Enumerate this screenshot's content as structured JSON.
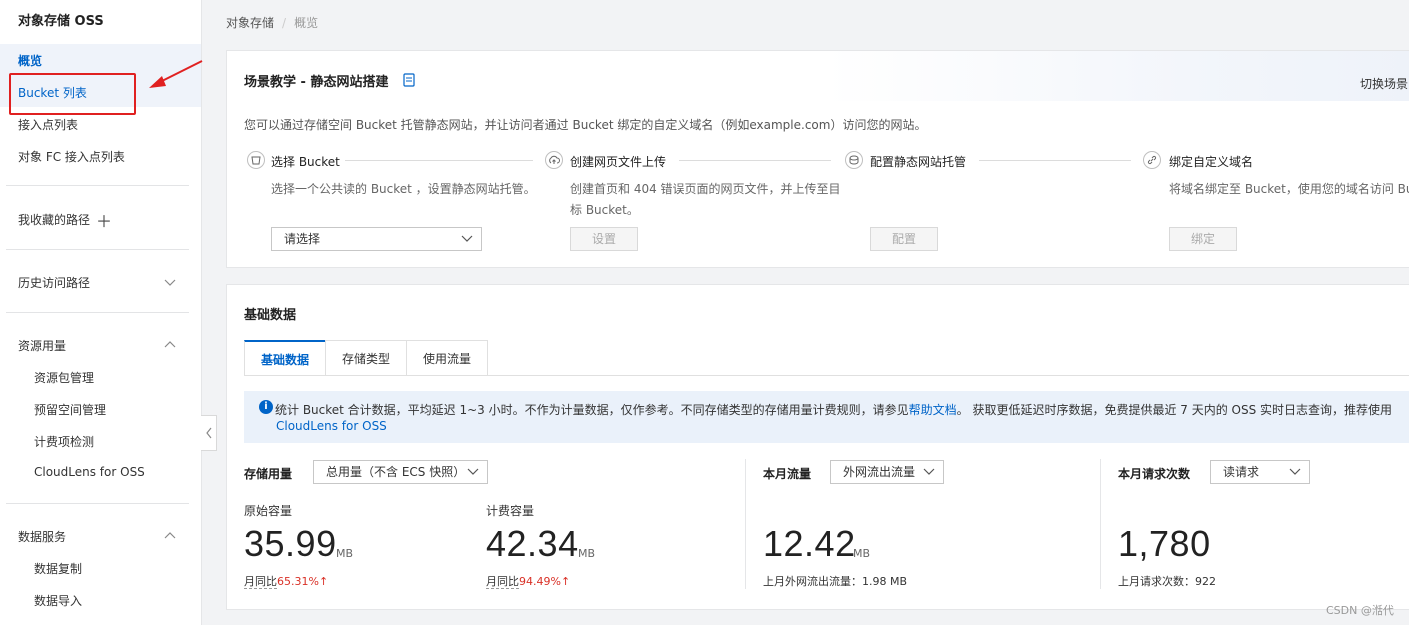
{
  "sidebar": {
    "title": "对象存储 OSS",
    "overview": "概览",
    "bucket_list": "Bucket 列表",
    "access_points": "接入点列表",
    "fc_access_points": "对象 FC 接入点列表",
    "favorites": "我收藏的路径",
    "history": "历史访问路径",
    "resource_usage": "资源用量",
    "resource_items": [
      "资源包管理",
      "预留空间管理",
      "计费项检测",
      "CloudLens for OSS"
    ],
    "data_services": "数据服务",
    "data_items": [
      "数据复制",
      "数据导入"
    ]
  },
  "breadcrumb": {
    "root": "对象存储",
    "current": "概览"
  },
  "scene": {
    "title": "场景教学 - 静态网站搭建",
    "switch": "切换场景",
    "description": "您可以通过存储空间 Bucket 托管静态网站，并让访问者通过 Bucket 绑定的自定义域名（例如example.com）访问您的网站。",
    "steps": [
      {
        "title": "选择 Bucket",
        "desc1": "选择一个公共读的 Bucket ，设置静态网站托管。",
        "desc2": "",
        "icon": "bucket-icon"
      },
      {
        "title": "创建网页文件上传",
        "desc1": "创建首页和 404 错误页面的网页文件，并上传至目",
        "desc2": "标 Bucket。",
        "icon": "cloud-upload-icon"
      },
      {
        "title": "配置静态网站托管",
        "desc1": "",
        "desc2": "",
        "icon": "config-icon"
      },
      {
        "title": "绑定自定义域名",
        "desc1": "将域名绑定至 Bucket，使用您的域名访问 Bu",
        "desc2": "",
        "icon": "link-icon"
      }
    ],
    "select_placeholder": "请选择",
    "btn_set": "设置",
    "btn_config": "配置",
    "btn_bind": "绑定"
  },
  "basic": {
    "title": "基础数据",
    "tabs": [
      "基础数据",
      "存储类型",
      "使用流量"
    ],
    "notice_prefix": "统计 Bucket 合计数据，平均延迟 1~3 小时。不作为计量数据，仅作参考。不同存储类型的存储用量计费规则，请参见",
    "notice_link": "帮助文档",
    "notice_suffix": "。 获取更低延迟时序数据，免费提供最近 7 天内的 OSS 实时日志查询，推荐使用",
    "notice_link2": "CloudLens for OSS",
    "storage_label": "存储用量",
    "storage_select": "总用量（不含 ECS 快照）",
    "raw_capacity_label": "原始容量",
    "raw_capacity_value": "35.99",
    "raw_capacity_unit": "MB",
    "raw_cmp_label": "月同比",
    "raw_cmp_value": "65.31%",
    "billed_capacity_label": "计费容量",
    "billed_capacity_value": "42.34",
    "billed_capacity_unit": "MB",
    "billed_cmp_label": "月同比",
    "billed_cmp_value": "94.49%",
    "traffic_label": "本月流量",
    "traffic_select": "外网流出流量",
    "traffic_value": "12.42",
    "traffic_unit": "MB",
    "traffic_prev": "上月外网流出流量：1.98 MB",
    "requests_label": "本月请求次数",
    "requests_select": "读请求",
    "requests_value": "1,780",
    "requests_prev": "上月请求次数：922"
  },
  "watermark": "CSDN @湉代",
  "colors": {
    "accent": "#0064c8",
    "annotation": "#e02020",
    "increase": "#d93026"
  }
}
